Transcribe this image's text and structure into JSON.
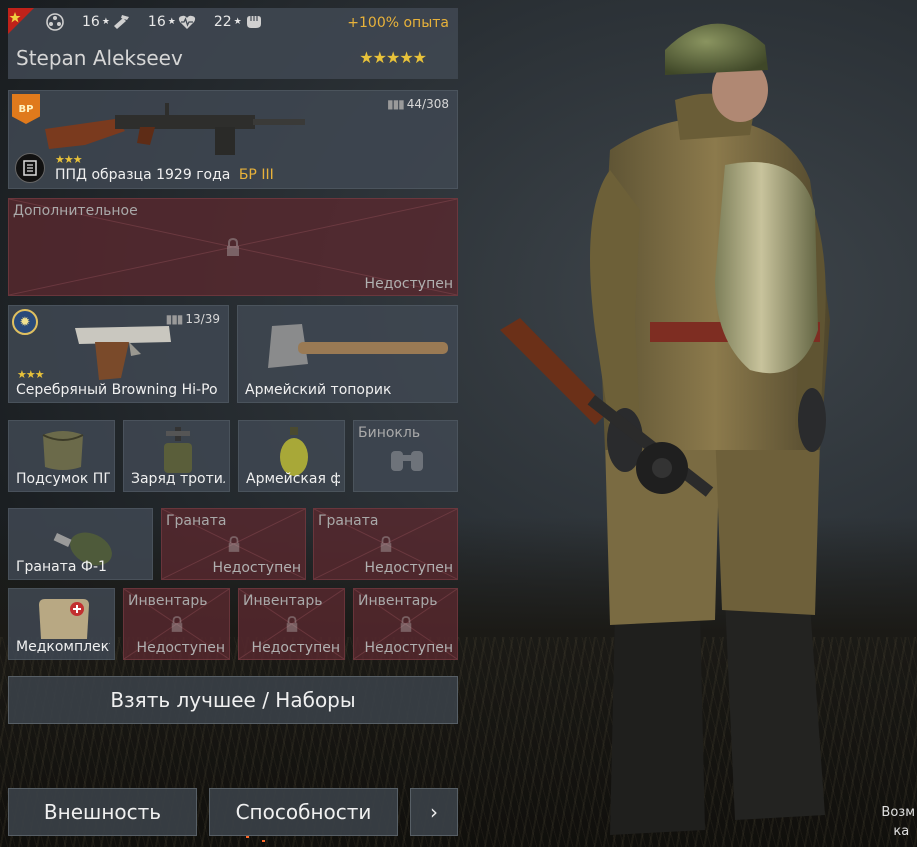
{
  "header": {
    "stats": [
      {
        "value": "16",
        "icon": "hammer-icon"
      },
      {
        "value": "16",
        "icon": "heart-icon"
      },
      {
        "value": "22",
        "icon": "fist-icon"
      }
    ],
    "exp_bonus": "+100% опыта",
    "soldier_name": "Stepan Alekseev",
    "soldier_stars": "★★★★★"
  },
  "primary_weapon": {
    "badge": "BP",
    "ammo": "44/308",
    "stars": "★★★",
    "name": "ППД образца 1929 года",
    "br": "БР III"
  },
  "additional_slot": {
    "title": "Дополнительное",
    "status": "Недоступен"
  },
  "secondary_weapon": {
    "ammo": "13/39",
    "stars": "★★★",
    "name": "Серебряный Browning Hi-Po"
  },
  "melee": {
    "name": "Армейский топорик"
  },
  "equipment": [
    {
      "name": "Подсумок ПП"
    },
    {
      "name": "Заряд тротила"
    },
    {
      "name": "Армейская ф"
    },
    {
      "title": "Бинокль"
    }
  ],
  "grenades": [
    {
      "name": "Граната Ф-1"
    },
    {
      "title": "Граната",
      "status": "Недоступен"
    },
    {
      "title": "Граната",
      "status": "Недоступен"
    }
  ],
  "inventory": [
    {
      "name": "Медкомплект"
    },
    {
      "title": "Инвентарь",
      "status": "Недоступен"
    },
    {
      "title": "Инвентарь",
      "status": "Недоступен"
    },
    {
      "title": "Инвентарь",
      "status": "Недоступен"
    }
  ],
  "buttons": {
    "best": "Взять лучшее / Наборы",
    "appearance": "Внешность",
    "abilities": "Способности",
    "more": "›"
  },
  "bg_hint": {
    "line1": "Возм",
    "line2": "ка"
  },
  "colors": {
    "slot": "#404852",
    "locked": "#58282e",
    "gold": "#e8c23a",
    "exp": "#e8b23a"
  }
}
